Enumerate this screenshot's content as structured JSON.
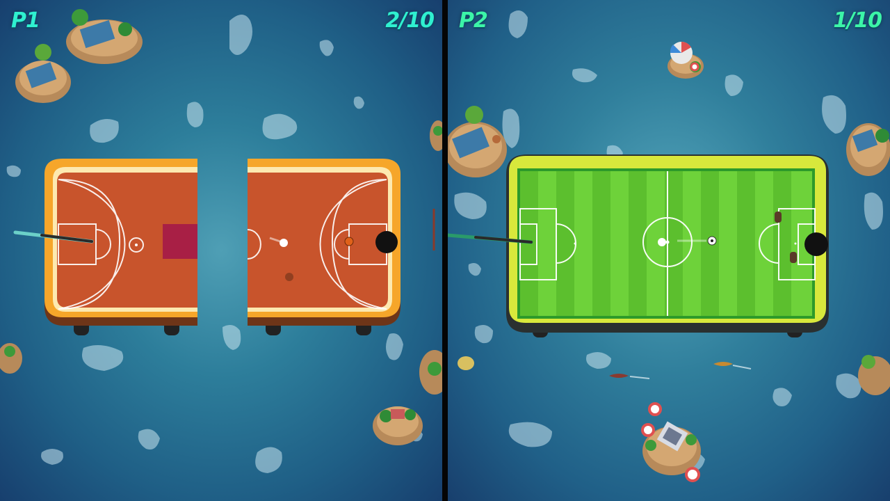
{
  "players": [
    {
      "label": "P1",
      "score": "2/10",
      "table_theme": "basketball-court"
    },
    {
      "label": "P2",
      "score": "1/10",
      "table_theme": "soccer-field"
    }
  ],
  "colors": {
    "water": "#2d7e9b",
    "hud_p1": "#2ff0d0",
    "hud_p2": "#3cf5a8",
    "court": "#c8542c",
    "court_frame": "#f6a62a",
    "pitch": "#6ed23a",
    "pitch_frame": "#d8e83c",
    "divider": "#050505"
  },
  "icons": [
    "cue-stick",
    "cue-ball",
    "basketball",
    "soccer-ball",
    "pocket-hole",
    "palm-tree",
    "island",
    "beach-umbrella",
    "life-ring",
    "speedboat"
  ]
}
